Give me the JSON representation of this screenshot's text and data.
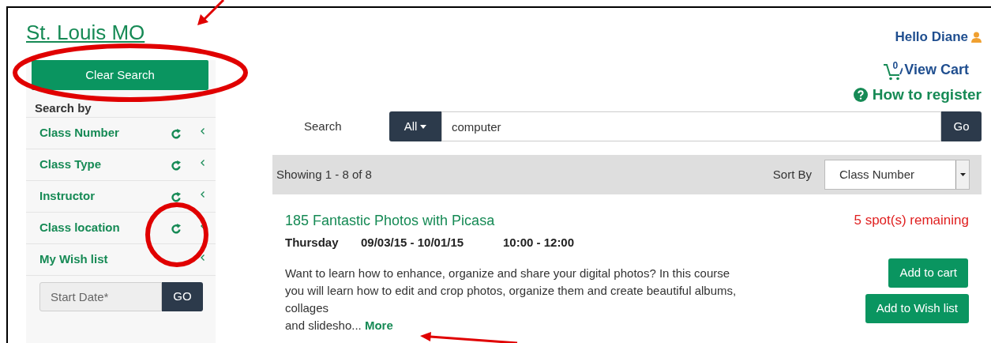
{
  "location": "St. Louis MO",
  "clear_search": "Clear Search",
  "search_by": "Search by",
  "filters": [
    {
      "label": "Class Number",
      "refresh": true
    },
    {
      "label": "Class Type",
      "refresh": true
    },
    {
      "label": "Instructor",
      "refresh": true
    },
    {
      "label": "Class location",
      "refresh": true
    },
    {
      "label": "My Wish list",
      "refresh": false
    }
  ],
  "start_date": {
    "placeholder": "Start Date*",
    "button": "GO"
  },
  "greeting": "Hello Diane",
  "cart": {
    "count": "0",
    "label": "View Cart"
  },
  "how_to_register": "How to register",
  "search": {
    "label": "Search",
    "scope": "All",
    "value": "computer",
    "button": "Go"
  },
  "results": {
    "showing": "Showing 1 - 8 of 8",
    "sort_label": "Sort By",
    "sort_value": "Class Number"
  },
  "classes": [
    {
      "title": "185 Fantastic Photos with Picasa",
      "remaining": "5 spot(s) remaining",
      "day": "Thursday",
      "dates": "09/03/15 - 10/01/15",
      "time": "10:00 - 12:00",
      "description": [
        "Want to learn how to enhance, organize and share your digital photos? In this course",
        "you will learn how to edit and crop photos, organize them and create beautiful albums,",
        "collages",
        "and slidesho..."
      ],
      "more": "More",
      "add_cart": "Add to cart",
      "add_wish": "Add to Wish list"
    }
  ]
}
